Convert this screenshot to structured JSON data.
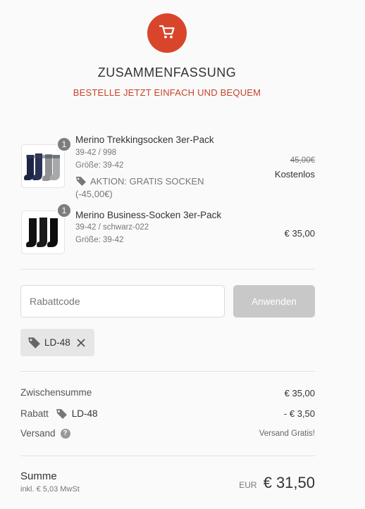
{
  "brand": {
    "accent": "#d9452b"
  },
  "header": {
    "title": "ZUSAMMENFASSUNG",
    "subtitle": "BESTELLE JETZT EINFACH UND BEQUEM",
    "cart_icon": "shopping-cart-icon"
  },
  "items": [
    {
      "quantity": "1",
      "name": "Merino Trekkingsocken 3er-Pack",
      "variant": "39-42 / 998",
      "size": "Größe: 39-42",
      "promo_label": "AKTION: GRATIS SOCKEN",
      "promo_amount": "(-45,00€)",
      "price_original": "45,00€",
      "price": "Kostenlos"
    },
    {
      "quantity": "1",
      "name": "Merino Business-Socken 3er-Pack",
      "variant": "39-42 / schwarz-022",
      "size": "Größe: 39-42",
      "price": "€ 35,00"
    }
  ],
  "coupon": {
    "placeholder": "Rabattcode",
    "apply_label": "Anwenden",
    "applied_code": "LD-48"
  },
  "summary": {
    "subtotal_label": "Zwischensumme",
    "subtotal_value": "€ 35,00",
    "discount_label": "Rabatt",
    "discount_code": "LD-48",
    "discount_value": "- € 3,50",
    "shipping_label": "Versand",
    "shipping_value": "Versand Gratis!"
  },
  "total": {
    "label": "Summe",
    "tax_note": "inkl. € 5,03 MwSt",
    "currency": "EUR",
    "value": "€ 31,50"
  }
}
